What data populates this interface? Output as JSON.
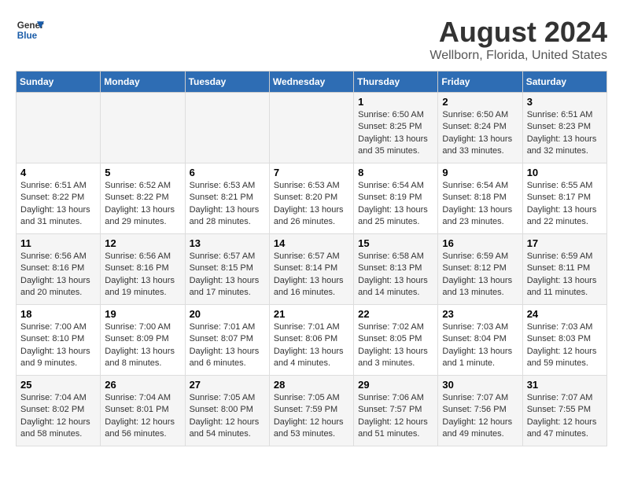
{
  "header": {
    "logo_line1": "General",
    "logo_line2": "Blue",
    "title": "August 2024",
    "subtitle": "Wellborn, Florida, United States"
  },
  "days_of_week": [
    "Sunday",
    "Monday",
    "Tuesday",
    "Wednesday",
    "Thursday",
    "Friday",
    "Saturday"
  ],
  "weeks": [
    [
      {
        "day": "",
        "info": ""
      },
      {
        "day": "",
        "info": ""
      },
      {
        "day": "",
        "info": ""
      },
      {
        "day": "",
        "info": ""
      },
      {
        "day": "1",
        "info": "Sunrise: 6:50 AM\nSunset: 8:25 PM\nDaylight: 13 hours\nand 35 minutes."
      },
      {
        "day": "2",
        "info": "Sunrise: 6:50 AM\nSunset: 8:24 PM\nDaylight: 13 hours\nand 33 minutes."
      },
      {
        "day": "3",
        "info": "Sunrise: 6:51 AM\nSunset: 8:23 PM\nDaylight: 13 hours\nand 32 minutes."
      }
    ],
    [
      {
        "day": "4",
        "info": "Sunrise: 6:51 AM\nSunset: 8:22 PM\nDaylight: 13 hours\nand 31 minutes."
      },
      {
        "day": "5",
        "info": "Sunrise: 6:52 AM\nSunset: 8:22 PM\nDaylight: 13 hours\nand 29 minutes."
      },
      {
        "day": "6",
        "info": "Sunrise: 6:53 AM\nSunset: 8:21 PM\nDaylight: 13 hours\nand 28 minutes."
      },
      {
        "day": "7",
        "info": "Sunrise: 6:53 AM\nSunset: 8:20 PM\nDaylight: 13 hours\nand 26 minutes."
      },
      {
        "day": "8",
        "info": "Sunrise: 6:54 AM\nSunset: 8:19 PM\nDaylight: 13 hours\nand 25 minutes."
      },
      {
        "day": "9",
        "info": "Sunrise: 6:54 AM\nSunset: 8:18 PM\nDaylight: 13 hours\nand 23 minutes."
      },
      {
        "day": "10",
        "info": "Sunrise: 6:55 AM\nSunset: 8:17 PM\nDaylight: 13 hours\nand 22 minutes."
      }
    ],
    [
      {
        "day": "11",
        "info": "Sunrise: 6:56 AM\nSunset: 8:16 PM\nDaylight: 13 hours\nand 20 minutes."
      },
      {
        "day": "12",
        "info": "Sunrise: 6:56 AM\nSunset: 8:16 PM\nDaylight: 13 hours\nand 19 minutes."
      },
      {
        "day": "13",
        "info": "Sunrise: 6:57 AM\nSunset: 8:15 PM\nDaylight: 13 hours\nand 17 minutes."
      },
      {
        "day": "14",
        "info": "Sunrise: 6:57 AM\nSunset: 8:14 PM\nDaylight: 13 hours\nand 16 minutes."
      },
      {
        "day": "15",
        "info": "Sunrise: 6:58 AM\nSunset: 8:13 PM\nDaylight: 13 hours\nand 14 minutes."
      },
      {
        "day": "16",
        "info": "Sunrise: 6:59 AM\nSunset: 8:12 PM\nDaylight: 13 hours\nand 13 minutes."
      },
      {
        "day": "17",
        "info": "Sunrise: 6:59 AM\nSunset: 8:11 PM\nDaylight: 13 hours\nand 11 minutes."
      }
    ],
    [
      {
        "day": "18",
        "info": "Sunrise: 7:00 AM\nSunset: 8:10 PM\nDaylight: 13 hours\nand 9 minutes."
      },
      {
        "day": "19",
        "info": "Sunrise: 7:00 AM\nSunset: 8:09 PM\nDaylight: 13 hours\nand 8 minutes."
      },
      {
        "day": "20",
        "info": "Sunrise: 7:01 AM\nSunset: 8:07 PM\nDaylight: 13 hours\nand 6 minutes."
      },
      {
        "day": "21",
        "info": "Sunrise: 7:01 AM\nSunset: 8:06 PM\nDaylight: 13 hours\nand 4 minutes."
      },
      {
        "day": "22",
        "info": "Sunrise: 7:02 AM\nSunset: 8:05 PM\nDaylight: 13 hours\nand 3 minutes."
      },
      {
        "day": "23",
        "info": "Sunrise: 7:03 AM\nSunset: 8:04 PM\nDaylight: 13 hours\nand 1 minute."
      },
      {
        "day": "24",
        "info": "Sunrise: 7:03 AM\nSunset: 8:03 PM\nDaylight: 12 hours\nand 59 minutes."
      }
    ],
    [
      {
        "day": "25",
        "info": "Sunrise: 7:04 AM\nSunset: 8:02 PM\nDaylight: 12 hours\nand 58 minutes."
      },
      {
        "day": "26",
        "info": "Sunrise: 7:04 AM\nSunset: 8:01 PM\nDaylight: 12 hours\nand 56 minutes."
      },
      {
        "day": "27",
        "info": "Sunrise: 7:05 AM\nSunset: 8:00 PM\nDaylight: 12 hours\nand 54 minutes."
      },
      {
        "day": "28",
        "info": "Sunrise: 7:05 AM\nSunset: 7:59 PM\nDaylight: 12 hours\nand 53 minutes."
      },
      {
        "day": "29",
        "info": "Sunrise: 7:06 AM\nSunset: 7:57 PM\nDaylight: 12 hours\nand 51 minutes."
      },
      {
        "day": "30",
        "info": "Sunrise: 7:07 AM\nSunset: 7:56 PM\nDaylight: 12 hours\nand 49 minutes."
      },
      {
        "day": "31",
        "info": "Sunrise: 7:07 AM\nSunset: 7:55 PM\nDaylight: 12 hours\nand 47 minutes."
      }
    ]
  ]
}
